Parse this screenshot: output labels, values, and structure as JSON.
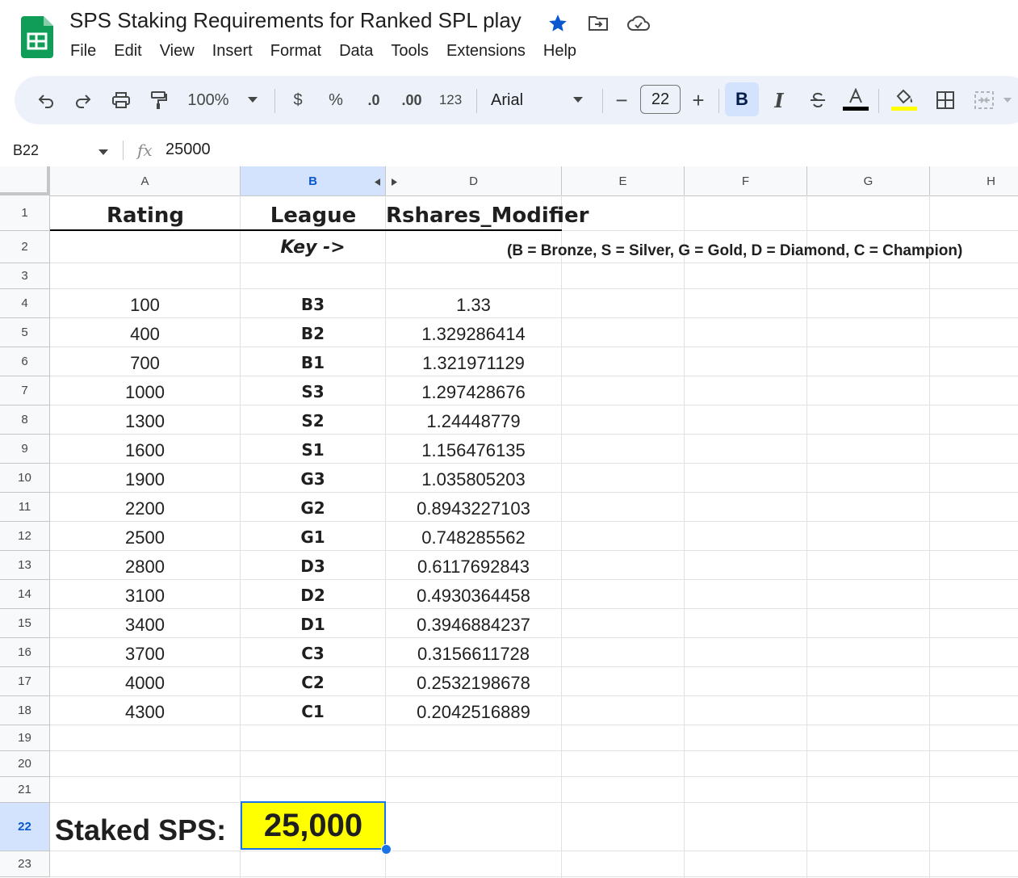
{
  "app": {
    "doc_title": "SPS Staking Requirements for Ranked SPL play",
    "menu": [
      "File",
      "Edit",
      "View",
      "Insert",
      "Format",
      "Data",
      "Tools",
      "Extensions",
      "Help"
    ]
  },
  "toolbar": {
    "zoom": "100%",
    "currency": "$",
    "percent": "%",
    "dec_decrease": ".0",
    "dec_increase": ".00",
    "number_format": "123",
    "font": "Arial",
    "font_size": "22",
    "minus": "−",
    "plus": "+",
    "bold": "B",
    "italic": "I"
  },
  "formula_bar": {
    "cell_ref": "B22",
    "fx": "fx",
    "value": "25000"
  },
  "columns": [
    "A",
    "B",
    "D",
    "E",
    "F",
    "G",
    "H"
  ],
  "rows": [
    "1",
    "2",
    "3",
    "4",
    "5",
    "6",
    "7",
    "8",
    "9",
    "10",
    "11",
    "12",
    "13",
    "14",
    "15",
    "16",
    "17",
    "18",
    "19",
    "20",
    "21",
    "22",
    "23"
  ],
  "sheet": {
    "header_rating": "Rating",
    "header_league": "League",
    "header_modifier": "Rshares_Modifier",
    "key_label": "Key ->",
    "key_legend": "(B = Bronze, S = Silver, G = Gold, D = Diamond, C = Champion)",
    "table": [
      {
        "rating": "100",
        "league": "B3",
        "modifier": "1.33"
      },
      {
        "rating": "400",
        "league": "B2",
        "modifier": "1.329286414"
      },
      {
        "rating": "700",
        "league": "B1",
        "modifier": "1.321971129"
      },
      {
        "rating": "1000",
        "league": "S3",
        "modifier": "1.297428676"
      },
      {
        "rating": "1300",
        "league": "S2",
        "modifier": "1.24448779"
      },
      {
        "rating": "1600",
        "league": "S1",
        "modifier": "1.156476135"
      },
      {
        "rating": "1900",
        "league": "G3",
        "modifier": "1.035805203"
      },
      {
        "rating": "2200",
        "league": "G2",
        "modifier": "0.8943227103"
      },
      {
        "rating": "2500",
        "league": "G1",
        "modifier": "0.748285562"
      },
      {
        "rating": "2800",
        "league": "D3",
        "modifier": "0.6117692843"
      },
      {
        "rating": "3100",
        "league": "D2",
        "modifier": "0.4930364458"
      },
      {
        "rating": "3400",
        "league": "D1",
        "modifier": "0.3946884237"
      },
      {
        "rating": "3700",
        "league": "C3",
        "modifier": "0.3156611728"
      },
      {
        "rating": "4000",
        "league": "C2",
        "modifier": "0.2532198678"
      },
      {
        "rating": "4300",
        "league": "C1",
        "modifier": "0.2042516889"
      }
    ],
    "staked_label": "Staked SPS:",
    "staked_value": "25,000"
  },
  "colors": {
    "selection_blue": "#1a73e8",
    "highlight_yellow": "#ffff00",
    "header_selected": "#d3e3fd",
    "toolbar_bg": "#edf2fa",
    "sheets_green": "#0f9d58",
    "star_blue": "#0b57d0"
  }
}
